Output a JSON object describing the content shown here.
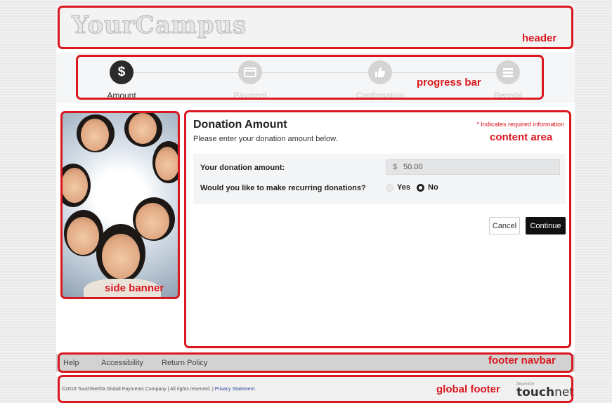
{
  "header": {
    "logo": "YourCampus"
  },
  "progress": {
    "steps": [
      {
        "label": "Amount",
        "icon": "$",
        "state": "active"
      },
      {
        "label": "Payment",
        "icon": "card-icon",
        "state": "inactive"
      },
      {
        "label": "Confirmation",
        "icon": "thumbs-up-icon",
        "state": "inactive"
      },
      {
        "label": "Receipt",
        "icon": "list-icon",
        "state": "inactive"
      }
    ]
  },
  "content": {
    "title": "Donation Amount",
    "subtitle": "Please enter your donation amount below.",
    "required_note": "* Indicates required information",
    "amount_label": "Your donation amount:",
    "currency": "$",
    "amount_value": "50.00",
    "recurring_label": "Would you like to make recurring donations?",
    "yes_label": "Yes",
    "no_label": "No",
    "cancel_label": "Cancel",
    "continue_label": "Continue"
  },
  "footer_nav": {
    "links": [
      "Help",
      "Accessibility",
      "Return Policy"
    ]
  },
  "global_footer": {
    "copyright_text": "©2018 TouchNet®A Global Payments Company  |  All rights reserved.  |",
    "privacy_link": "Privacy Statement",
    "secured_by": "Secured by",
    "brand_touch": "touch",
    "brand_net": "net"
  },
  "annotations": {
    "header": "header",
    "progress_bar": "progress bar",
    "content_area": "content area",
    "side_banner": "side banner",
    "footer_navbar": "footer navbar",
    "global_footer": "global footer"
  },
  "colors": {
    "annotation": "#d9181f",
    "active_step": "#2a2a2a",
    "continue_button": "#111111"
  }
}
